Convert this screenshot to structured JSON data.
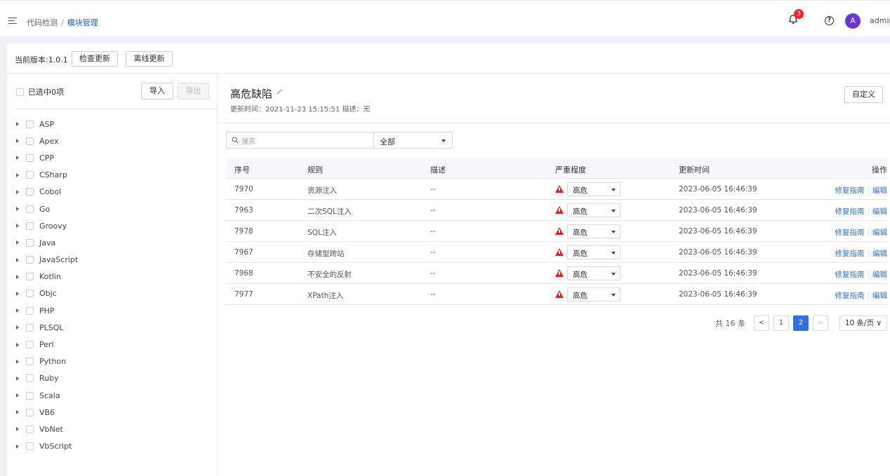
{
  "header": {
    "breadcrumb": [
      "代码检测",
      "模块管理"
    ],
    "notification_count": "3",
    "avatar_letter": "A",
    "username": "admin"
  },
  "version": {
    "label": "当前版本:1.0.1",
    "check_button": "检查更新",
    "offline_button": "离线更新"
  },
  "left": {
    "select_all": "已选中0项",
    "import_button": "导入",
    "export_button": "导出",
    "languages": [
      "ASP",
      "Apex",
      "CPP",
      "CSharp",
      "Cobol",
      "Go",
      "Groovy",
      "Java",
      "JavaScript",
      "Kotlin",
      "Objc",
      "PHP",
      "PLSQL",
      "Perl",
      "Python",
      "Ruby",
      "Scala",
      "VB6",
      "VbNet",
      "VbScript"
    ]
  },
  "detail": {
    "title": "高危缺陷",
    "meta": "更新时间：2021-11-23 15:15:51    描述：无",
    "custom_button": "自定义",
    "search_placeholder": "搜索",
    "filter_value": "全部"
  },
  "table": {
    "headers": [
      "序号",
      "规则",
      "描述",
      "严重程度",
      "更新时间",
      "操作"
    ],
    "rows": [
      {
        "id": "7970",
        "rule": "资源注入",
        "desc": "--",
        "severity": "高危",
        "time": "2023-06-05 16:46:39"
      },
      {
        "id": "7963",
        "rule": "二次SQL注入",
        "desc": "--",
        "severity": "高危",
        "time": "2023-06-05 16:46:39"
      },
      {
        "id": "7978",
        "rule": "SQL注入",
        "desc": "--",
        "severity": "高危",
        "time": "2023-06-05 16:46:39"
      },
      {
        "id": "7967",
        "rule": "存储型跨站",
        "desc": "--",
        "severity": "高危",
        "time": "2023-06-05 16:46:39"
      },
      {
        "id": "7968",
        "rule": "不安全的反射",
        "desc": "--",
        "severity": "高危",
        "time": "2023-06-05 16:46:39"
      },
      {
        "id": "7977",
        "rule": "XPath注入",
        "desc": "--",
        "severity": "高危",
        "time": "2023-06-05 16:46:39"
      }
    ],
    "op_guide": "修复指南",
    "op_edit": "编辑",
    "severity_color": "#e02020"
  },
  "pagination": {
    "total": "共 16 条",
    "prev": "<",
    "pages": [
      "1",
      "2"
    ],
    "current": "2",
    "next": ">",
    "page_size": "10 条/页"
  },
  "colors": {
    "accent": "#2f6fde",
    "avatar": "#6c36d6",
    "badge": "#f5222d"
  }
}
